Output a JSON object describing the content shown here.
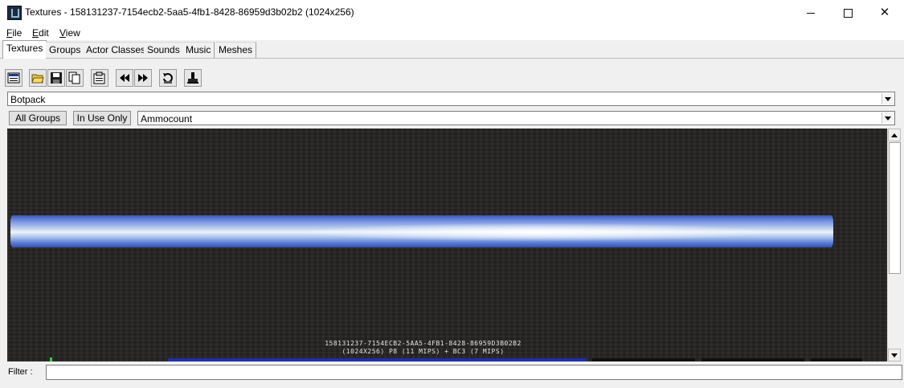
{
  "window": {
    "title": "Textures - 158131237-7154ecb2-5aa5-4fb1-8428-86959d3b02b2 (1024x256)",
    "minimize_glyph": "",
    "maximize_glyph": "",
    "close_glyph": "✕"
  },
  "menu": [
    {
      "accel": "F",
      "rest": "ile"
    },
    {
      "accel": "E",
      "rest": "dit"
    },
    {
      "accel": "V",
      "rest": "iew"
    }
  ],
  "tabs": [
    "Textures",
    "Groups",
    "Actor Classes",
    "Sounds",
    "Music",
    "Meshes"
  ],
  "active_tab": "Textures",
  "toolbar": {
    "icons": [
      "properties-icon",
      "open-icon",
      "save-icon",
      "copy-icon",
      "settings-icon",
      "previous-icon",
      "next-icon",
      "refresh-icon",
      "import-icon"
    ]
  },
  "package": {
    "value": "Botpack"
  },
  "buttons": {
    "all_groups": "All Groups",
    "in_use_only": "In Use Only"
  },
  "group": {
    "value": "Ammocount"
  },
  "viewer": {
    "texture_name": "158131237-7154ECB2-5AA5-4FB1-8428-86959D3B02B2",
    "texture_info": "(1024X256) P8 (11 MIPS) + BC3 (7 MIPS)",
    "colors": {
      "background": "#272524",
      "strip_blue": "#4a68c8",
      "selection_bar": "#1f2fa8",
      "thumb_bar": "#101010",
      "marker": "#33d133"
    }
  },
  "filter": {
    "label": "Filter :",
    "value": "",
    "placeholder": ""
  }
}
